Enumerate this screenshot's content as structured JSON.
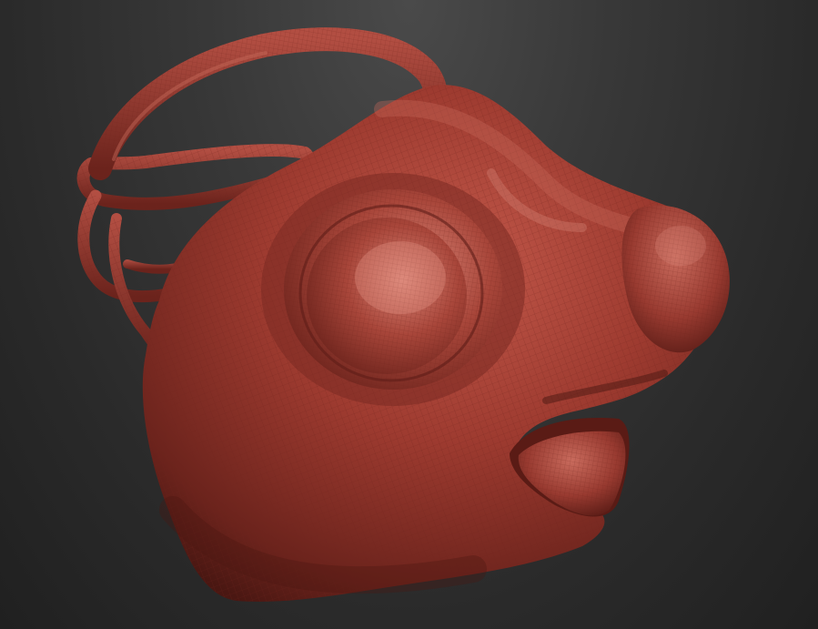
{
  "viewport": {
    "background_color": "#2a2a2a",
    "background_highlight": "#4a4a4a"
  },
  "model": {
    "material_base_color": "#9c3d32",
    "material_shadow_color": "#4a1712",
    "material_highlight_color": "#d27a6c",
    "wireframe_color": "#7a2c24",
    "polyframe_visible": true,
    "parts": [
      "mask-body",
      "eye-socket",
      "snout",
      "lower-lip",
      "top-strap",
      "side-strap-loops"
    ]
  }
}
